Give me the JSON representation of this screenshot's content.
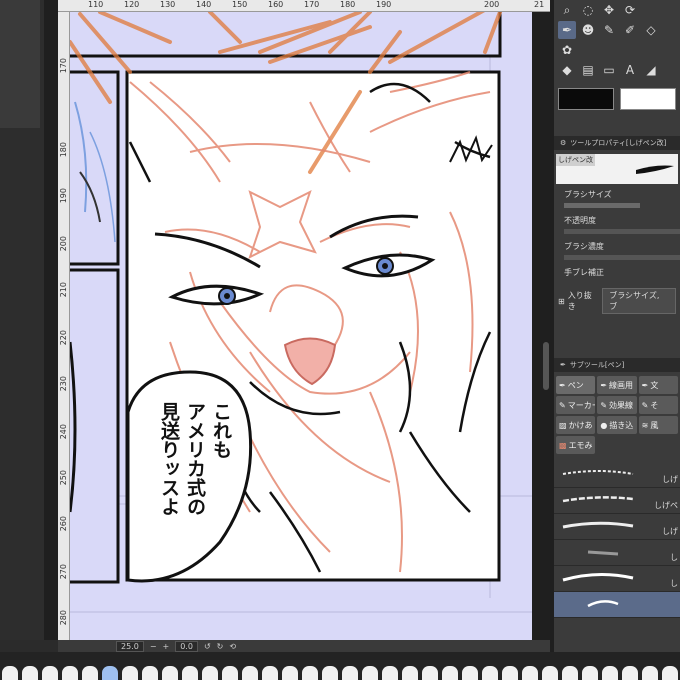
{
  "ruler_h": {
    "ticks": [
      "110",
      "120",
      "130",
      "140",
      "150",
      "160",
      "170",
      "180",
      "190",
      "200",
      "21"
    ]
  },
  "ruler_v": {
    "ticks": [
      "170",
      "180",
      "190",
      "200",
      "210",
      "220",
      "230",
      "240",
      "250",
      "260",
      "270",
      "280"
    ]
  },
  "speech_bubble": {
    "lines": [
      "これも",
      "アメリカ式の",
      "見送りッスよ"
    ]
  },
  "status_bar": {
    "zoom": "25.0",
    "rotation": "0.0"
  },
  "tool_property": {
    "title": "ツールプロパティ[しげペン改]",
    "brush_tag": "しげペン改",
    "rows": [
      {
        "label": "ブラシサイズ"
      },
      {
        "label": "不透明度"
      },
      {
        "label": "ブラシ濃度"
      },
      {
        "label": "手ブレ補正"
      }
    ],
    "in_out_label": "入り抜き",
    "in_out_value": "ブラシサイズ, ブ"
  },
  "sub_tool": {
    "title": "サブツール[ペン]",
    "buttons": [
      "ペン",
      "線画用",
      "文",
      "マーカー",
      "効果線",
      "そ",
      "かけあ",
      "描き込",
      "風",
      "エモみ"
    ]
  },
  "brush_list": {
    "names": [
      "しげ",
      "しげペ",
      "しげ",
      "し",
      "し",
      ""
    ]
  },
  "colors": {
    "main": "#0a0a0a",
    "sub": "#ffffff",
    "accent": "#5b6b8a",
    "canvas_bg": "#d9d9f8",
    "panel_border": "#111111",
    "guide_orange": "#e07a3a",
    "sketch_red": "#e48870"
  }
}
